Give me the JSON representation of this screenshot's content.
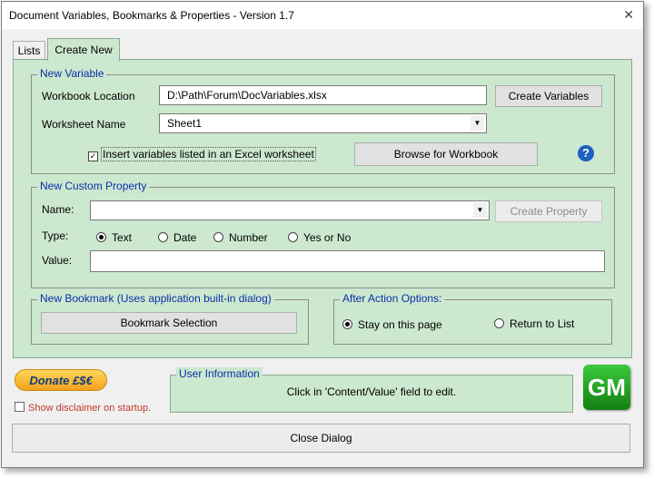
{
  "window": {
    "title": "Document Variables, Bookmarks & Properties - Version 1.7",
    "close_glyph": "✕"
  },
  "tabs": [
    {
      "label": "Lists"
    },
    {
      "label": "Create New"
    }
  ],
  "new_variable": {
    "group_label": "New Variable",
    "workbook_location_label": "Workbook Location",
    "workbook_location_value": "D:\\Path\\Forum\\DocVariables.xlsx",
    "create_variables_label": "Create Variables",
    "worksheet_name_label": "Worksheet Name",
    "worksheet_name_value": "Sheet1",
    "insert_checkbox_label": "Insert variables listed in an Excel worksheet",
    "insert_checked": true,
    "browse_label": "Browse for Workbook",
    "help_glyph": "?"
  },
  "custom_property": {
    "group_label": "New Custom Property",
    "name_label": "Name:",
    "name_value": "",
    "create_property_label": "Create Property",
    "type_label": "Type:",
    "type_options": [
      {
        "label": "Text",
        "selected": true
      },
      {
        "label": "Date",
        "selected": false
      },
      {
        "label": "Number",
        "selected": false
      },
      {
        "label": "Yes or No",
        "selected": false
      }
    ],
    "value_label": "Value:",
    "value_value": ""
  },
  "bookmark": {
    "group_label": "New Bookmark (Uses application built-in dialog)",
    "selection_label": "Bookmark Selection"
  },
  "after_action": {
    "group_label": "After Action Options:",
    "options": [
      {
        "label": "Stay on this page",
        "selected": true
      },
      {
        "label": "Return to List",
        "selected": false
      }
    ]
  },
  "footer": {
    "donate_label": "Donate £$€",
    "disclaimer_label": "Show disclaimer on startup.",
    "disclaimer_checked": false,
    "user_info_label": "User Information",
    "user_info_text": "Click in 'Content/Value' field to edit.",
    "logo_text": "GM",
    "close_label": "Close Dialog"
  },
  "colors": {
    "panel": "#cce8cf",
    "group_label": "#0b2fa8",
    "disclaimer": "#c0392b",
    "logo": "#1b8f1b",
    "help": "#1f5fbf"
  }
}
